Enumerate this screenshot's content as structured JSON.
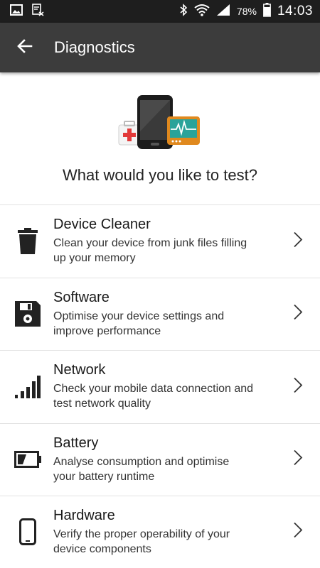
{
  "status_bar": {
    "battery_percent": "78%",
    "time": "14:03"
  },
  "app_bar": {
    "title": "Diagnostics"
  },
  "hero": {
    "question": "What would you like to test?"
  },
  "menu": {
    "items": [
      {
        "title": "Device Cleaner",
        "desc_line1": "Clean your device from junk files filling",
        "desc_line2": "up your memory",
        "icon": "trash-icon"
      },
      {
        "title": "Software",
        "desc_line1": "Optimise your device settings and",
        "desc_line2": "improve performance",
        "icon": "floppy-disk-icon"
      },
      {
        "title": "Network",
        "desc_line1": "Check your mobile data connection and",
        "desc_line2": "test network quality",
        "icon": "signal-bars-icon"
      },
      {
        "title": "Battery",
        "desc_line1": "Analyse consumption and optimise",
        "desc_line2": "your battery runtime",
        "icon": "battery-icon"
      },
      {
        "title": "Hardware",
        "desc_line1": "Verify the proper operability of your",
        "desc_line2": "device components",
        "icon": "phone-icon"
      }
    ]
  },
  "colors": {
    "status_bar": "#1e1e1e",
    "app_bar": "#3c3c3c",
    "monitor_orange": "#e0891e",
    "monitor_screen": "#2aa39a",
    "medkit_red": "#e23a3a"
  }
}
